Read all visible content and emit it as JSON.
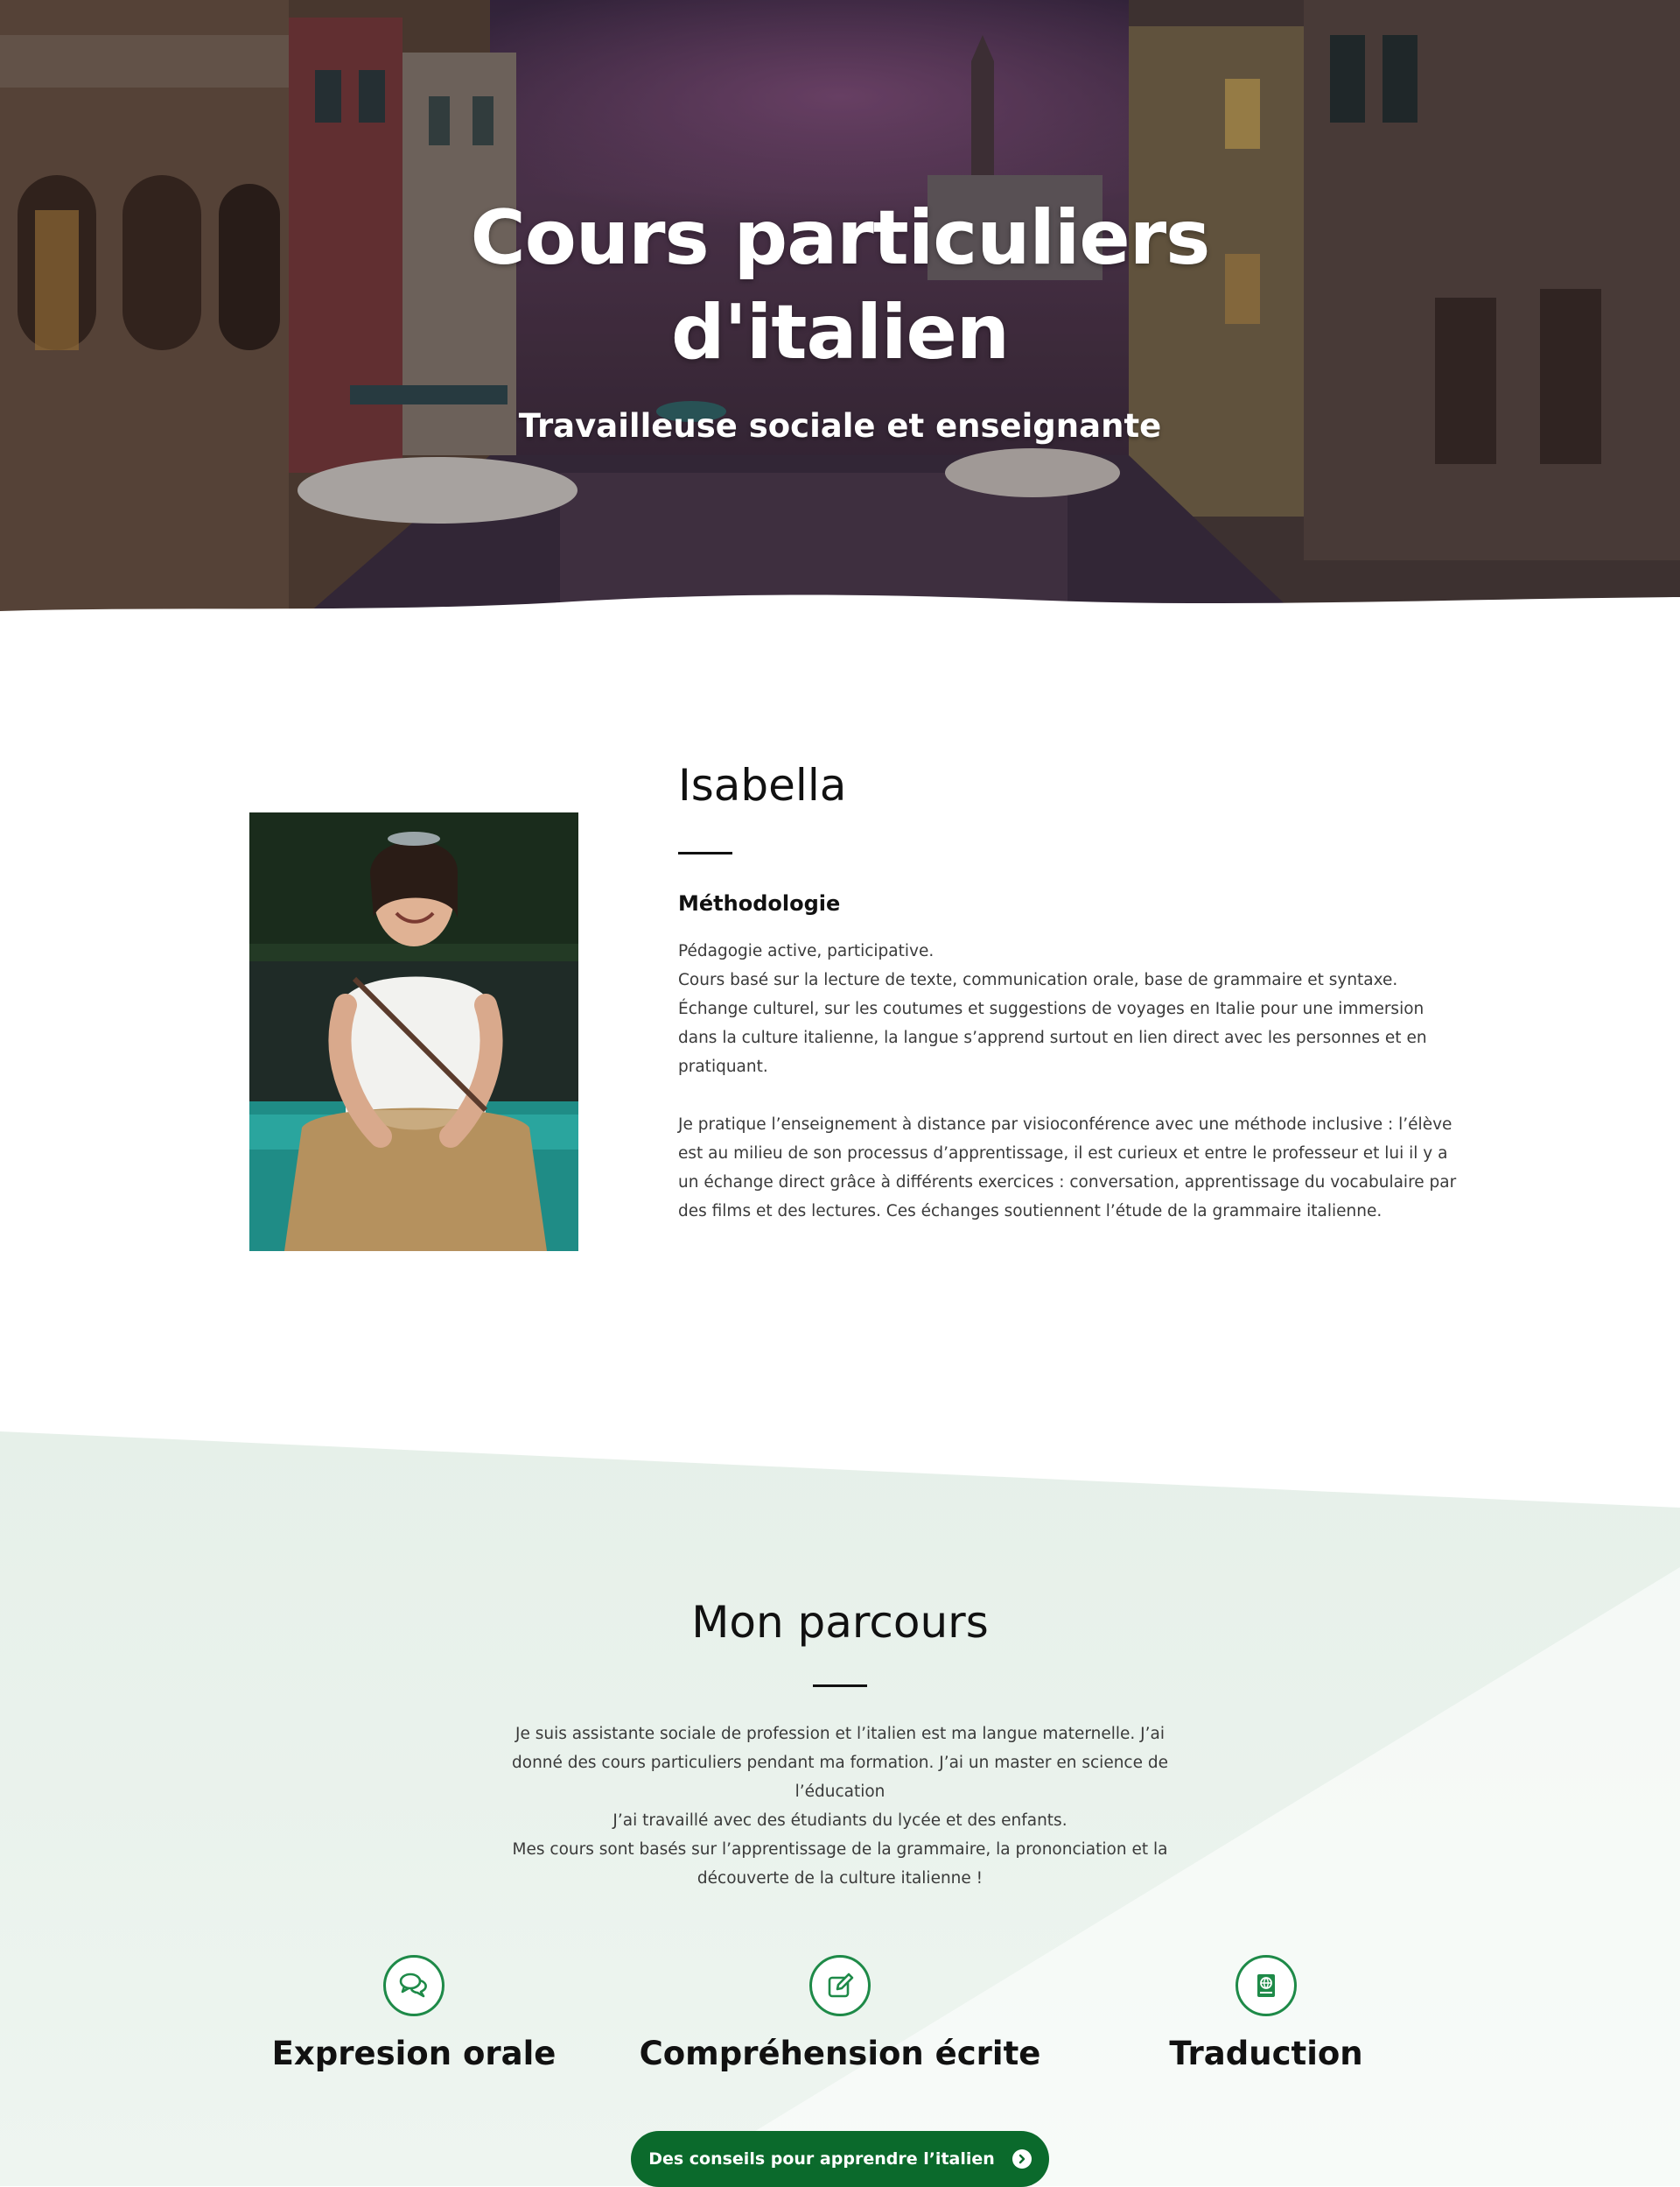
{
  "hero": {
    "title": "Cours particuliers d'italien",
    "subtitle": "Travailleuse sociale et enseignante"
  },
  "about": {
    "name": "Isabella",
    "subheading": "Méthodologie",
    "paragraphs": [
      "Pédagogie active, participative.\nCours basé sur la lecture de texte, communication orale, base de grammaire et syntaxe.\nÉchange culturel, sur les coutumes et suggestions de voyages en Italie pour une immersion dans la culture italienne, la langue s’apprend surtout en lien direct avec les personnes et en pratiquant.",
      "Je pratique l’enseignement à distance par visioconférence avec une méthode inclusive : l’élève est au milieu de son processus d’apprentissage, il est curieux et entre le professeur et lui il y a un échange direct grâce à différents exercices : conversation, apprentissage du vocabulaire par des films et des lectures. Ces échanges soutiennent l’étude de la grammaire italienne."
    ]
  },
  "parcours": {
    "title": "Mon parcours",
    "lines": [
      "Je suis assistante sociale de profession et l’italien est ma langue maternelle. J’ai donné des cours particuliers pendant ma formation. J’ai un master en science de l’éducation",
      "J’ai travaillé avec des étudiants du lycée et des enfants.",
      "Mes cours sont basés sur l’apprentissage de la grammaire, la prononciation et la découverte de la culture italienne !"
    ],
    "features": [
      {
        "label": "Expresion orale",
        "icon": "chat-bubbles-icon"
      },
      {
        "label": "Compréhension écrite",
        "icon": "edit-note-icon"
      },
      {
        "label": "Traduction",
        "icon": "book-globe-icon"
      }
    ],
    "cta_label": "Des conseils pour apprendre l’italien"
  },
  "colors": {
    "accent": "#1e8a48",
    "button": "#0b6a2c",
    "section_tint": "#e6f0e9"
  }
}
